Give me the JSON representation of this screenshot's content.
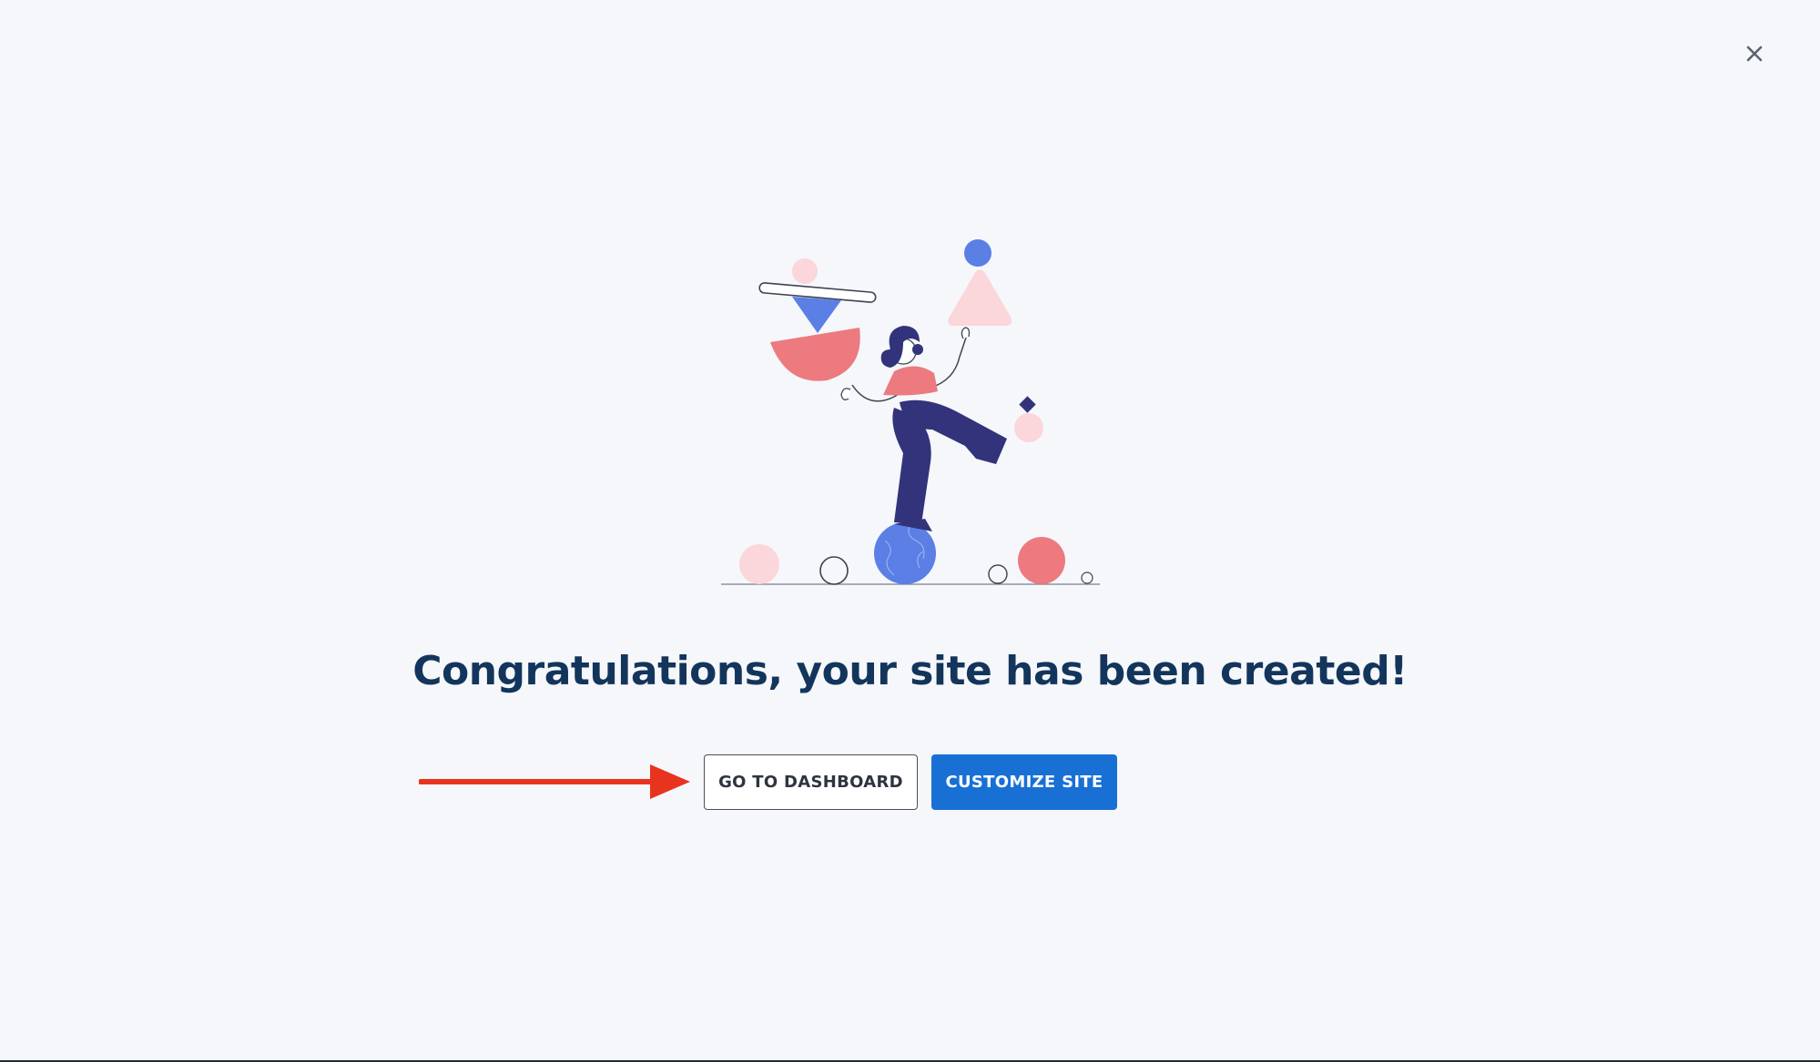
{
  "header": {
    "close_icon": "close-icon"
  },
  "main": {
    "headline": "Congratulations, your site has been created!",
    "illustration": "balancing-person-illustration"
  },
  "actions": {
    "dashboard_label": "GO TO DASHBOARD",
    "customize_label": "CUSTOMIZE SITE"
  },
  "annotation": {
    "arrow": "red-arrow-icon"
  },
  "colors": {
    "background": "#f5f7fb",
    "headline": "#13355b",
    "primary": "#1870d5",
    "coral": "#ec7a7f",
    "pink": "#fbd6db",
    "blue": "#5b7fe5",
    "navy": "#32337a",
    "arrow": "#e8341f"
  }
}
